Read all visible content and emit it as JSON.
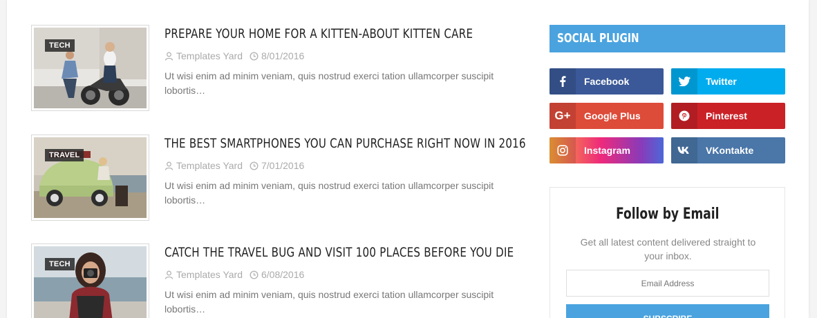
{
  "posts": [
    {
      "tag": "TECH",
      "title": "PREPARE YOUR HOME FOR A KITTEN-ABOUT KITTEN CARE",
      "author": "Templates Yard",
      "date": "8/01/2016",
      "excerpt": "Ut wisi enim ad minim veniam, quis nostrud exerci tation ullamcorper suscipit lobortis…"
    },
    {
      "tag": "TRAVEL",
      "title": "THE BEST SMARTPHONES YOU CAN PURCHASE RIGHT NOW IN 2016",
      "author": "Templates Yard",
      "date": "7/01/2016",
      "excerpt": "Ut wisi enim ad minim veniam, quis nostrud exerci tation ullamcorper suscipit lobortis…"
    },
    {
      "tag": "TECH",
      "title": "CATCH THE TRAVEL BUG AND VISIT 100 PLACES BEFORE YOU DIE",
      "author": "Templates Yard",
      "date": "6/08/2016",
      "excerpt": "Ut wisi enim ad minim veniam, quis nostrud exerci tation ullamcorper suscipit lobortis…"
    }
  ],
  "sidebar": {
    "social_title": "SOCIAL PLUGIN",
    "social": [
      {
        "label": "Facebook",
        "icon": "facebook-icon",
        "color": "#3b5998"
      },
      {
        "label": "Twitter",
        "icon": "twitter-icon",
        "color": "#00acee"
      },
      {
        "label": "Google Plus",
        "icon": "google-plus-icon",
        "color": "#dd4b39"
      },
      {
        "label": "Pinterest",
        "icon": "pinterest-icon",
        "color": "#ca2127"
      },
      {
        "label": "Instagram",
        "icon": "instagram-icon",
        "color": "#c13584"
      },
      {
        "label": "VKontakte",
        "icon": "vk-icon",
        "color": "#4a76a8"
      }
    ],
    "follow": {
      "title": "Follow by Email",
      "description": "Get all latest content delivered straight to your inbox.",
      "email_placeholder": "Email Address",
      "subscribe_label": "SUBSCRIBE"
    }
  },
  "colors": {
    "accent": "#4aa3df"
  }
}
